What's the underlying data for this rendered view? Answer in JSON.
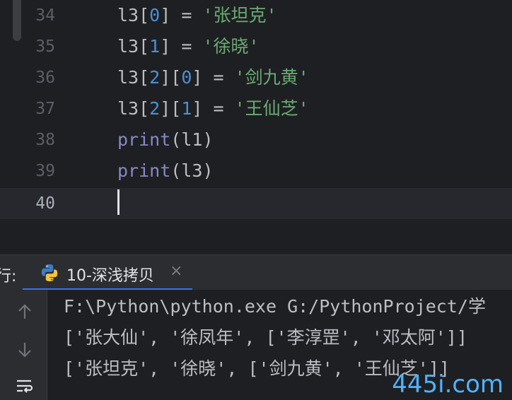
{
  "editor": {
    "line_numbers": [
      "34",
      "35",
      "36",
      "37",
      "38",
      "39",
      "40"
    ],
    "lines": [
      {
        "var": "l3",
        "idx1": "0",
        "str": "'张坦克'"
      },
      {
        "var": "l3",
        "idx1": "1",
        "str": "'徐晓'"
      },
      {
        "var": "l3",
        "idx1": "2",
        "idx2": "0",
        "str": "'剑九黄'"
      },
      {
        "var": "l3",
        "idx1": "2",
        "idx2": "1",
        "str": "'王仙芝'"
      },
      {
        "fn": "print",
        "arg": "l1"
      },
      {
        "fn": "print",
        "arg": "l3"
      }
    ]
  },
  "run_panel": {
    "label": "行:",
    "tab_title": "10-深浅拷贝",
    "close_glyph": "×",
    "console_lines": [
      "F:\\Python\\python.exe G:/PythonProject/学",
      "['张大仙', '徐凤年', ['李淳罡', '邓太阿']]",
      "['张坦克', '徐晓', ['剑九黄', '王仙芝']]"
    ]
  },
  "watermark": "445i.com",
  "colors": {
    "editor_bg": "#1e1f22",
    "panel_bg": "#2b2d30",
    "string": "#6aab73",
    "number": "#4a8fd6",
    "builtin": "#8888c6",
    "accent": "#3574f0"
  },
  "icons": {
    "tab": "python-icon",
    "close": "close-icon",
    "side": [
      "arrow-up-icon",
      "arrow-down-icon",
      "soft-wrap-icon"
    ]
  }
}
